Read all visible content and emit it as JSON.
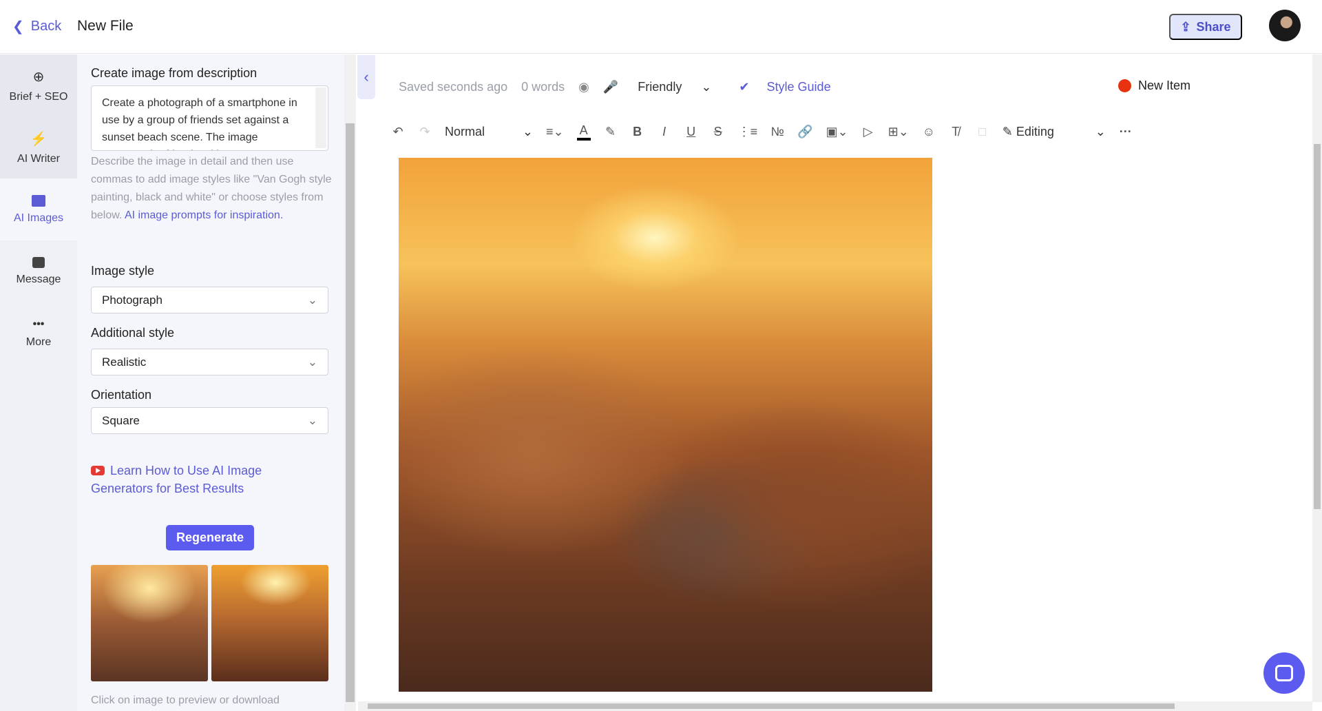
{
  "header": {
    "back_label": "Back",
    "title": "New File",
    "share_label": "Share"
  },
  "rail": {
    "items": [
      {
        "label": "Brief + SEO",
        "icon": "crosshair-icon"
      },
      {
        "label": "AI Writer",
        "icon": "lightning-icon"
      },
      {
        "label": "AI Images",
        "icon": "image-icon",
        "active": true
      },
      {
        "label": "Message",
        "icon": "message-icon"
      },
      {
        "label": "More",
        "icon": "more-icon"
      }
    ]
  },
  "panel": {
    "description_label": "Create image from description",
    "description_value": "Create a photograph of a smartphone in use by a group of friends set against a sunset beach scene. The image captures the friends taking",
    "help_text": "Describe the image in detail and then use commas to add image styles like \"Van Gogh style painting, black and white\" or choose styles from below.",
    "help_link": "AI image prompts for inspiration.",
    "image_style_label": "Image style",
    "image_style_value": "Photograph",
    "additional_style_label": "Additional style",
    "additional_style_value": "Realistic",
    "orientation_label": "Orientation",
    "orientation_value": "Square",
    "learn_link": "Learn How to Use AI Image Generators for Best Results",
    "regenerate_label": "Regenerate",
    "caption": "Click on image to preview or download"
  },
  "editor": {
    "saved": "Saved seconds ago",
    "words": "0 words",
    "tone": "Friendly",
    "style_guide": "Style Guide",
    "new_item": "New Item",
    "status_color": "#e8320f",
    "accent": "#5b5bf0",
    "toolbar": {
      "block_format": "Normal",
      "mode": "Editing"
    }
  }
}
